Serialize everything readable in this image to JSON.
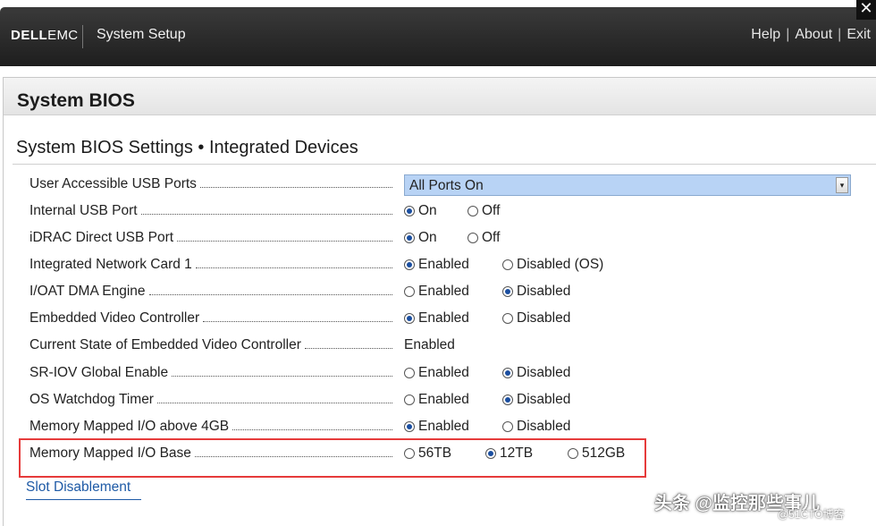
{
  "header": {
    "logo_brand": "DELL",
    "logo_sub": "EMC",
    "app_title": "System Setup",
    "links": [
      "Help",
      "About",
      "Exit"
    ],
    "close": "✕"
  },
  "page_title": "System BIOS",
  "section_title": "System BIOS Settings • Integrated Devices",
  "rows": [
    {
      "label": "User Accessible USB Ports",
      "dropdown_value": "All Ports On"
    },
    {
      "label": "Internal USB Port",
      "options": [
        "On",
        "Off"
      ],
      "selected": 0
    },
    {
      "label": "iDRAC Direct USB Port",
      "options": [
        "On",
        "Off"
      ],
      "selected": 0
    },
    {
      "label": "Integrated Network Card 1",
      "options": [
        "Enabled",
        "Disabled (OS)"
      ],
      "selected": 0
    },
    {
      "label": "I/OAT DMA Engine",
      "options": [
        "Enabled",
        "Disabled"
      ],
      "selected": 1
    },
    {
      "label": "Embedded Video Controller",
      "options": [
        "Enabled",
        "Disabled"
      ],
      "selected": 0
    },
    {
      "label": "Current State of Embedded Video Controller",
      "static_value": "Enabled"
    },
    {
      "label": "SR-IOV Global Enable",
      "options": [
        "Enabled",
        "Disabled"
      ],
      "selected": 1
    },
    {
      "label": "OS Watchdog Timer",
      "options": [
        "Enabled",
        "Disabled"
      ],
      "selected": 1
    },
    {
      "label": "Memory Mapped I/O above 4GB",
      "options": [
        "Enabled",
        "Disabled"
      ],
      "selected": 0
    },
    {
      "label": "Memory Mapped I/O Base",
      "options": [
        "56TB",
        "12TB",
        "512GB"
      ],
      "selected": 1
    }
  ],
  "slot_link": "Slot Disablement",
  "watermark": "头条 @监控那些事儿",
  "watermark_sub": "@51CTO博客",
  "colors": {
    "highlight": "#e63b3b",
    "dropdown_bg": "#b8d3f5",
    "link": "#1e5aa6"
  }
}
